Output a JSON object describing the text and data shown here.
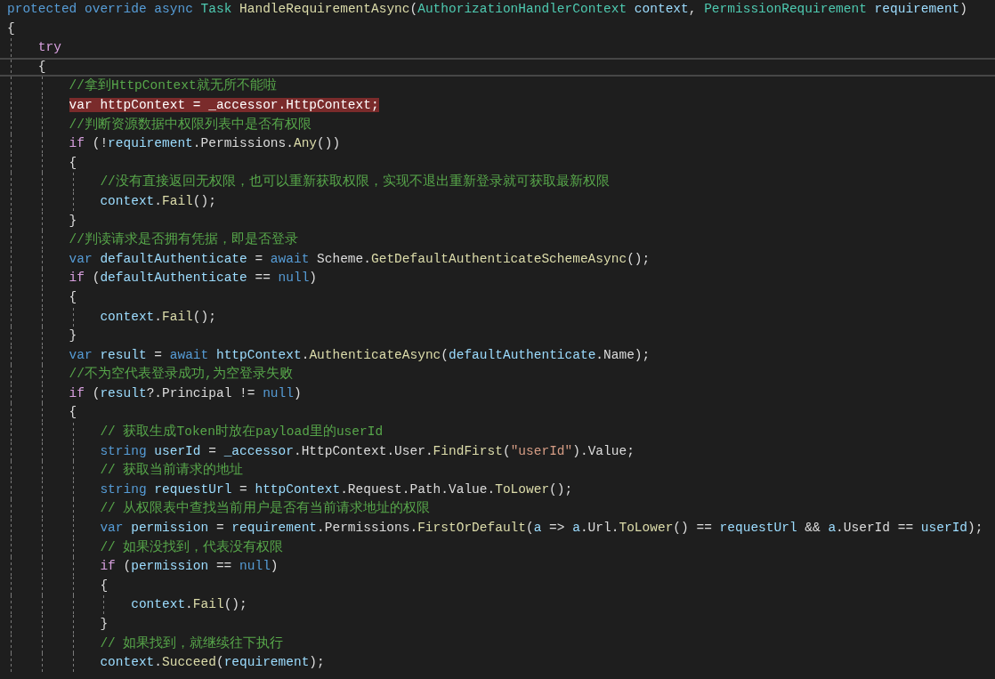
{
  "editor": {
    "lines": [
      {
        "current": false,
        "highlighted": false,
        "tokens": [
          {
            "kind": "kw",
            "text": "protected override async "
          },
          {
            "kind": "type",
            "text": "Task "
          },
          {
            "kind": "method",
            "text": "HandleRequirementAsync"
          },
          {
            "kind": "plain",
            "text": "("
          },
          {
            "kind": "type",
            "text": "AuthorizationHandlerContext "
          },
          {
            "kind": "var",
            "text": "context"
          },
          {
            "kind": "plain",
            "text": ", "
          },
          {
            "kind": "type",
            "text": "PermissionRequirement "
          },
          {
            "kind": "var",
            "text": "requirement"
          },
          {
            "kind": "plain",
            "text": ")"
          }
        ]
      },
      {
        "current": false,
        "highlighted": false,
        "tokens": [
          {
            "kind": "plain",
            "text": "{"
          }
        ]
      },
      {
        "current": false,
        "highlighted": false,
        "tokens": [
          {
            "kind": "ctl",
            "text": "    try"
          }
        ]
      },
      {
        "current": true,
        "highlighted": false,
        "tokens": [
          {
            "kind": "plain",
            "text": "    {"
          }
        ]
      },
      {
        "current": false,
        "highlighted": false,
        "tokens": [
          {
            "kind": "comment",
            "text": "        //拿到HttpContext就无所不能啦"
          }
        ]
      },
      {
        "current": false,
        "highlighted": true,
        "tokens": [
          {
            "kind": "plain",
            "text": "        var httpContext = _accessor.HttpContext;"
          }
        ]
      },
      {
        "current": false,
        "highlighted": false,
        "tokens": [
          {
            "kind": "comment",
            "text": "        //判断资源数据中权限列表中是否有权限"
          }
        ]
      },
      {
        "current": false,
        "highlighted": false,
        "tokens": [
          {
            "kind": "ctl",
            "text": "        if"
          },
          {
            "kind": "plain",
            "text": " (!"
          },
          {
            "kind": "var",
            "text": "requirement"
          },
          {
            "kind": "plain",
            "text": ".Permissions."
          },
          {
            "kind": "method",
            "text": "Any"
          },
          {
            "kind": "plain",
            "text": "())"
          }
        ]
      },
      {
        "current": false,
        "highlighted": false,
        "tokens": [
          {
            "kind": "plain",
            "text": "        {"
          }
        ]
      },
      {
        "current": false,
        "highlighted": false,
        "tokens": [
          {
            "kind": "comment",
            "text": "            //没有直接返回无权限，也可以重新获取权限，实现不退出重新登录就可获取最新权限"
          }
        ]
      },
      {
        "current": false,
        "highlighted": false,
        "tokens": [
          {
            "kind": "var",
            "text": "            context"
          },
          {
            "kind": "plain",
            "text": "."
          },
          {
            "kind": "method",
            "text": "Fail"
          },
          {
            "kind": "plain",
            "text": "();"
          }
        ]
      },
      {
        "current": false,
        "highlighted": false,
        "tokens": [
          {
            "kind": "plain",
            "text": "        }"
          }
        ]
      },
      {
        "current": false,
        "highlighted": false,
        "tokens": [
          {
            "kind": "comment",
            "text": "        //判读请求是否拥有凭据，即是否登录"
          }
        ]
      },
      {
        "current": false,
        "highlighted": false,
        "tokens": [
          {
            "kind": "kw",
            "text": "        var "
          },
          {
            "kind": "var",
            "text": "defaultAuthenticate"
          },
          {
            "kind": "plain",
            "text": " = "
          },
          {
            "kind": "kw",
            "text": "await "
          },
          {
            "kind": "plain",
            "text": "Scheme."
          },
          {
            "kind": "method",
            "text": "GetDefaultAuthenticateSchemeAsync"
          },
          {
            "kind": "plain",
            "text": "();"
          }
        ]
      },
      {
        "current": false,
        "highlighted": false,
        "tokens": [
          {
            "kind": "ctl",
            "text": "        if"
          },
          {
            "kind": "plain",
            "text": " ("
          },
          {
            "kind": "var",
            "text": "defaultAuthenticate"
          },
          {
            "kind": "plain",
            "text": " == "
          },
          {
            "kind": "kw",
            "text": "null"
          },
          {
            "kind": "plain",
            "text": ")"
          }
        ]
      },
      {
        "current": false,
        "highlighted": false,
        "tokens": [
          {
            "kind": "plain",
            "text": "        {"
          }
        ]
      },
      {
        "current": false,
        "highlighted": false,
        "tokens": [
          {
            "kind": "var",
            "text": "            context"
          },
          {
            "kind": "plain",
            "text": "."
          },
          {
            "kind": "method",
            "text": "Fail"
          },
          {
            "kind": "plain",
            "text": "();"
          }
        ]
      },
      {
        "current": false,
        "highlighted": false,
        "tokens": [
          {
            "kind": "plain",
            "text": "        }"
          }
        ]
      },
      {
        "current": false,
        "highlighted": false,
        "tokens": [
          {
            "kind": "kw",
            "text": "        var "
          },
          {
            "kind": "var",
            "text": "result"
          },
          {
            "kind": "plain",
            "text": " = "
          },
          {
            "kind": "kw",
            "text": "await "
          },
          {
            "kind": "var",
            "text": "httpContext"
          },
          {
            "kind": "plain",
            "text": "."
          },
          {
            "kind": "method",
            "text": "AuthenticateAsync"
          },
          {
            "kind": "plain",
            "text": "("
          },
          {
            "kind": "var",
            "text": "defaultAuthenticate"
          },
          {
            "kind": "plain",
            "text": ".Name);"
          }
        ]
      },
      {
        "current": false,
        "highlighted": false,
        "tokens": [
          {
            "kind": "comment",
            "text": "        //不为空代表登录成功,为空登录失败"
          }
        ]
      },
      {
        "current": false,
        "highlighted": false,
        "tokens": [
          {
            "kind": "ctl",
            "text": "        if"
          },
          {
            "kind": "plain",
            "text": " ("
          },
          {
            "kind": "var",
            "text": "result"
          },
          {
            "kind": "plain",
            "text": "?.Principal != "
          },
          {
            "kind": "kw",
            "text": "null"
          },
          {
            "kind": "plain",
            "text": ")"
          }
        ]
      },
      {
        "current": false,
        "highlighted": false,
        "tokens": [
          {
            "kind": "plain",
            "text": "        {"
          }
        ]
      },
      {
        "current": false,
        "highlighted": false,
        "tokens": [
          {
            "kind": "comment",
            "text": "            // 获取生成Token时放在payload里的userId"
          }
        ]
      },
      {
        "current": false,
        "highlighted": false,
        "tokens": [
          {
            "kind": "kw",
            "text": "            string "
          },
          {
            "kind": "var",
            "text": "userId"
          },
          {
            "kind": "plain",
            "text": " = "
          },
          {
            "kind": "var",
            "text": "_accessor"
          },
          {
            "kind": "plain",
            "text": ".HttpContext.User."
          },
          {
            "kind": "method",
            "text": "FindFirst"
          },
          {
            "kind": "plain",
            "text": "("
          },
          {
            "kind": "str",
            "text": "\"userId\""
          },
          {
            "kind": "plain",
            "text": ").Value;"
          }
        ]
      },
      {
        "current": false,
        "highlighted": false,
        "tokens": [
          {
            "kind": "comment",
            "text": "            // 获取当前请求的地址"
          }
        ]
      },
      {
        "current": false,
        "highlighted": false,
        "tokens": [
          {
            "kind": "kw",
            "text": "            string "
          },
          {
            "kind": "var",
            "text": "requestUrl"
          },
          {
            "kind": "plain",
            "text": " = "
          },
          {
            "kind": "var",
            "text": "httpContext"
          },
          {
            "kind": "plain",
            "text": ".Request.Path.Value."
          },
          {
            "kind": "method",
            "text": "ToLower"
          },
          {
            "kind": "plain",
            "text": "();"
          }
        ]
      },
      {
        "current": false,
        "highlighted": false,
        "tokens": [
          {
            "kind": "comment",
            "text": "            // 从权限表中查找当前用户是否有当前请求地址的权限"
          }
        ]
      },
      {
        "current": false,
        "highlighted": false,
        "tokens": [
          {
            "kind": "kw",
            "text": "            var "
          },
          {
            "kind": "var",
            "text": "permission"
          },
          {
            "kind": "plain",
            "text": " = "
          },
          {
            "kind": "var",
            "text": "requirement"
          },
          {
            "kind": "plain",
            "text": ".Permissions."
          },
          {
            "kind": "method",
            "text": "FirstOrDefault"
          },
          {
            "kind": "plain",
            "text": "("
          },
          {
            "kind": "var",
            "text": "a"
          },
          {
            "kind": "plain",
            "text": " => "
          },
          {
            "kind": "var",
            "text": "a"
          },
          {
            "kind": "plain",
            "text": ".Url."
          },
          {
            "kind": "method",
            "text": "ToLower"
          },
          {
            "kind": "plain",
            "text": "() == "
          },
          {
            "kind": "var",
            "text": "requestUrl"
          },
          {
            "kind": "plain",
            "text": " && "
          },
          {
            "kind": "var",
            "text": "a"
          },
          {
            "kind": "plain",
            "text": ".UserId == "
          },
          {
            "kind": "var",
            "text": "userId"
          },
          {
            "kind": "plain",
            "text": ");"
          }
        ]
      },
      {
        "current": false,
        "highlighted": false,
        "tokens": [
          {
            "kind": "comment",
            "text": "            // 如果没找到，代表没有权限"
          }
        ]
      },
      {
        "current": false,
        "highlighted": false,
        "tokens": [
          {
            "kind": "ctl",
            "text": "            if"
          },
          {
            "kind": "plain",
            "text": " ("
          },
          {
            "kind": "var",
            "text": "permission"
          },
          {
            "kind": "plain",
            "text": " == "
          },
          {
            "kind": "kw",
            "text": "null"
          },
          {
            "kind": "plain",
            "text": ")"
          }
        ]
      },
      {
        "current": false,
        "highlighted": false,
        "tokens": [
          {
            "kind": "plain",
            "text": "            {"
          }
        ]
      },
      {
        "current": false,
        "highlighted": false,
        "tokens": [
          {
            "kind": "var",
            "text": "                context"
          },
          {
            "kind": "plain",
            "text": "."
          },
          {
            "kind": "method",
            "text": "Fail"
          },
          {
            "kind": "plain",
            "text": "();"
          }
        ]
      },
      {
        "current": false,
        "highlighted": false,
        "tokens": [
          {
            "kind": "plain",
            "text": "            }"
          }
        ]
      },
      {
        "current": false,
        "highlighted": false,
        "tokens": [
          {
            "kind": "comment",
            "text": "            // 如果找到，就继续往下执行"
          }
        ]
      },
      {
        "current": false,
        "highlighted": false,
        "tokens": [
          {
            "kind": "var",
            "text": "            context"
          },
          {
            "kind": "plain",
            "text": "."
          },
          {
            "kind": "method",
            "text": "Succeed"
          },
          {
            "kind": "plain",
            "text": "("
          },
          {
            "kind": "var",
            "text": "requirement"
          },
          {
            "kind": "plain",
            "text": ");"
          }
        ]
      }
    ]
  }
}
